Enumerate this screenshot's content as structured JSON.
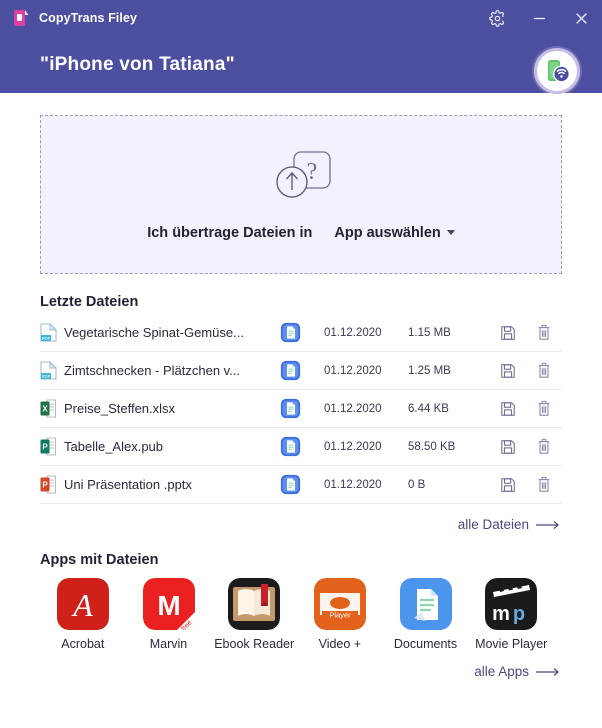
{
  "window": {
    "app_name": "CopyTrans Filey",
    "brand_icon": "copytrans-logo-icon",
    "settings_icon": "gear-icon",
    "minimize_icon": "minimize-icon",
    "close_icon": "close-icon",
    "header_color": "#4c4fa0"
  },
  "device": {
    "name": "\"iPhone von Tatiana\"",
    "status_icon": "phone-wifi-connected-icon"
  },
  "dropzone": {
    "icon": "upload-unknown-file-icon",
    "text": "Ich übertrage Dateien in",
    "select_label": "App auswählen",
    "caret_icon": "chevron-down-icon",
    "background": "#f3f2fc",
    "border_color": "#9a9ac4"
  },
  "recent": {
    "heading": "Letzte Dateien",
    "more_label": "alle Dateien",
    "more_icon": "arrow-right-icon",
    "save_icon": "floppy-save-icon",
    "delete_icon": "trash-delete-icon",
    "app_icon": "documents-app-icon",
    "files": [
      {
        "name": "Vegetarische Spinat-Gemüse...",
        "type_icon": "pdf-file-icon",
        "type_color": "#3fb6d8",
        "date": "01.12.2020",
        "size": "1.15 MB"
      },
      {
        "name": "Zimtschnecken - Plätzchen v...",
        "type_icon": "pdf-file-icon",
        "type_color": "#3fb6d8",
        "date": "01.12.2020",
        "size": "1.25 MB"
      },
      {
        "name": "Preise_Steffen.xlsx",
        "type_icon": "excel-file-icon",
        "type_color": "#217346",
        "date": "01.12.2020",
        "size": "6.44 KB"
      },
      {
        "name": "Tabelle_Alex.pub",
        "type_icon": "publisher-file-icon",
        "type_color": "#0e7a62",
        "date": "01.12.2020",
        "size": "58.50 KB"
      },
      {
        "name": "Uni Präsentation .pptx",
        "type_icon": "powerpoint-file-icon",
        "type_color": "#d24726",
        "date": "01.12.2020",
        "size": "0 B"
      }
    ]
  },
  "apps": {
    "heading": "Apps mit Dateien",
    "more_label": "alle Apps",
    "more_icon": "arrow-right-icon",
    "items": [
      {
        "label": "Acrobat",
        "icon": "acrobat-app-icon",
        "bg": "#d0201a"
      },
      {
        "label": "Marvin",
        "icon": "marvin-app-icon",
        "bg": "#ea2021"
      },
      {
        "label": "Ebook Reader",
        "icon": "ebook-reader-app-icon",
        "bg": "#1b1b1b"
      },
      {
        "label": "Video +",
        "icon": "video-plus-app-icon",
        "bg": "#e2621b"
      },
      {
        "label": "Documents",
        "icon": "documents-app-icon",
        "bg": "#3b8ae8"
      },
      {
        "label": "Movie Player",
        "icon": "movie-player-app-icon",
        "bg": "#1a1a1a"
      }
    ]
  }
}
